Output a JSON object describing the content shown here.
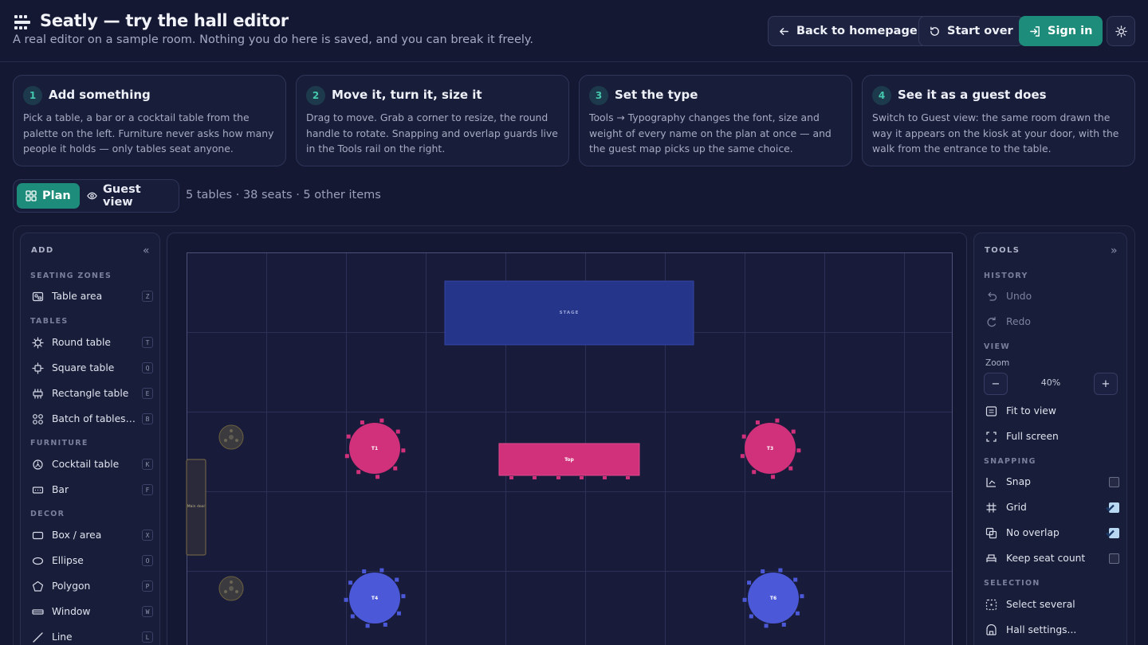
{
  "header": {
    "title": "Seatly — try the hall editor",
    "subtitle": "A real editor on a sample room. Nothing you do here is saved, and you can break it freely.",
    "back_label": "Back to homepage",
    "start_over_label": "Start over",
    "sign_in_label": "Sign in",
    "theme_icon": "sun-icon"
  },
  "steps": [
    {
      "num": "1",
      "title": "Add something",
      "body": "Pick a table, a bar or a cocktail table from the palette on the left. Furniture never asks how many people it holds — only tables seat anyone."
    },
    {
      "num": "2",
      "title": "Move it, turn it, size it",
      "body": "Drag to move. Grab a corner to resize, the round handle to rotate. Snapping and overlap guards live in the Tools rail on the right."
    },
    {
      "num": "3",
      "title": "Set the type",
      "body": "Tools → Typography changes the font, size and weight of every name on the plan at once — and the guest map picks up the same choice."
    },
    {
      "num": "4",
      "title": "See it as a guest does",
      "body": "Switch to Guest view: the same room drawn the way it appears on the kiosk at your door, with the walk from the entrance to the table."
    }
  ],
  "modes": {
    "plan": "Plan",
    "guest": "Guest view",
    "active": "plan"
  },
  "stats": "5 tables · 38 seats · 5 other items",
  "add_panel": {
    "title": "ADD",
    "collapse": "«",
    "sections": [
      {
        "label": "SEATING ZONES",
        "items": [
          {
            "label": "Table area",
            "key": "Z",
            "icon": "table-area-icon"
          }
        ]
      },
      {
        "label": "TABLES",
        "items": [
          {
            "label": "Round table",
            "key": "T",
            "icon": "round-table-icon"
          },
          {
            "label": "Square table",
            "key": "Q",
            "icon": "square-table-icon"
          },
          {
            "label": "Rectangle table",
            "key": "E",
            "icon": "rectangle-table-icon"
          },
          {
            "label": "Batch of tables…",
            "key": "B",
            "icon": "batch-tables-icon"
          }
        ]
      },
      {
        "label": "FURNITURE",
        "items": [
          {
            "label": "Cocktail table",
            "key": "K",
            "icon": "cocktail-table-icon"
          },
          {
            "label": "Bar",
            "key": "F",
            "icon": "bar-icon"
          }
        ]
      },
      {
        "label": "DECOR",
        "items": [
          {
            "label": "Box / area",
            "key": "X",
            "icon": "box-icon"
          },
          {
            "label": "Ellipse",
            "key": "O",
            "icon": "ellipse-icon"
          },
          {
            "label": "Polygon",
            "key": "P",
            "icon": "polygon-icon"
          },
          {
            "label": "Window",
            "key": "W",
            "icon": "window-icon"
          },
          {
            "label": "Line",
            "key": "L",
            "icon": "line-icon"
          }
        ]
      }
    ]
  },
  "tools_panel": {
    "title": "TOOLS",
    "collapse": "»",
    "history_label": "HISTORY",
    "undo": "Undo",
    "redo": "Redo",
    "view_label": "VIEW",
    "zoom_label": "Zoom",
    "zoom_value": "40%",
    "zoom_minus": "−",
    "zoom_plus": "+",
    "fit": "Fit to view",
    "fullscreen": "Full screen",
    "snapping_label": "SNAPPING",
    "snap": {
      "label": "Snap",
      "checked": false
    },
    "grid": {
      "label": "Grid",
      "checked": true
    },
    "no_overlap": {
      "label": "No overlap",
      "checked": true
    },
    "keep_seat": {
      "label": "Keep seat count",
      "checked": false
    },
    "selection_label": "SELECTION",
    "select_several": "Select several",
    "hall_settings": "Hall settings..."
  },
  "canvas": {
    "stage_label": "STAGE",
    "top_label": "Top",
    "door_label": "Main door",
    "tables": {
      "t1": "T1",
      "t3": "T3",
      "t4": "T4",
      "t6": "T6"
    }
  },
  "colors": {
    "accent": "#1d8c7a",
    "pink": "#d1307a",
    "blue": "#4b59d8",
    "stage": "#25358a"
  }
}
